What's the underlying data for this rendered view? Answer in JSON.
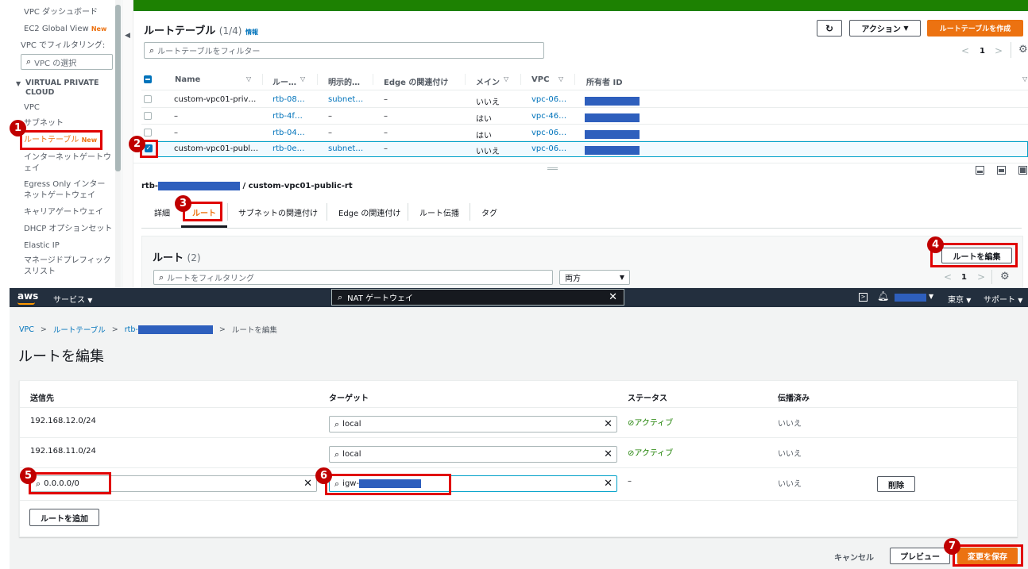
{
  "sidebar": {
    "dashboard": "VPC ダッシュボード",
    "ec2_global_view": "EC2 Global View",
    "new_badge": "New",
    "filter_label": "VPC でフィルタリング:",
    "vpc_select_placeholder": "VPC の選択",
    "section_title": "VIRTUAL PRIVATE CLOUD",
    "items": [
      "VPC",
      "サブネット",
      "ルートテーブル",
      "インターネットゲートウェイ",
      "Egress Only インターネットゲートウェイ",
      "キャリアゲートウェイ",
      "DHCP オプションセット",
      "Elastic IP",
      "マネージドプレフィックスリスト"
    ]
  },
  "top": {
    "title": "ルートテーブル",
    "count": "(1/4)",
    "info": "情報",
    "actions_label": "アクション",
    "create_label": "ルートテーブルを作成",
    "filter_placeholder": "ルートテーブルをフィルター",
    "page": "1",
    "columns": [
      "Name",
      "ルー…",
      "明示的…",
      "Edge の関連付け",
      "メイン",
      "VPC",
      "所有者 ID"
    ],
    "rows": [
      {
        "name": "custom-vpc01-priv…",
        "rt": "rtb-08…",
        "explicit": "subnet…",
        "edge": "–",
        "main": "いいえ",
        "vpc": "vpc-06…"
      },
      {
        "name": "–",
        "rt": "rtb-4f…",
        "explicit": "–",
        "edge": "–",
        "main": "はい",
        "vpc": "vpc-46…"
      },
      {
        "name": "–",
        "rt": "rtb-04…",
        "explicit": "–",
        "edge": "–",
        "main": "はい",
        "vpc": "vpc-06…"
      },
      {
        "name": "custom-vpc01-publ…",
        "rt": "rtb-0e…",
        "explicit": "subnet…",
        "edge": "–",
        "main": "いいえ",
        "vpc": "vpc-06…"
      }
    ]
  },
  "detail": {
    "prefix": "rtb-",
    "suffix": "/ custom-vpc01-public-rt",
    "tabs": [
      "詳細",
      "ルート",
      "サブネットの関連付け",
      "Edge の関連付け",
      "ルート伝播",
      "タグ"
    ],
    "routes_title": "ルート",
    "routes_count": "(2)",
    "edit_routes_label": "ルートを編集",
    "route_filter_placeholder": "ルートをフィルタリング",
    "both_option": "両方",
    "page": "1"
  },
  "awsnav": {
    "logo": "aws",
    "services": "サービス",
    "search_value": "NAT ゲートウェイ",
    "region": "東京",
    "support": "サポート"
  },
  "edit": {
    "breadcrumb": [
      "VPC",
      "ルートテーブル",
      "rtb-",
      "ルートを編集"
    ],
    "title": "ルートを編集",
    "columns": [
      "送信先",
      "ターゲット",
      "ステータス",
      "伝播済み"
    ],
    "rows": [
      {
        "dest": "192.168.12.0/24",
        "target": "local",
        "status": "アクティブ",
        "propagated": "いいえ"
      },
      {
        "dest": "192.168.11.0/24",
        "target": "local",
        "status": "アクティブ",
        "propagated": "いいえ"
      },
      {
        "dest": "0.0.0.0/0",
        "target": "igw-",
        "status": "–",
        "propagated": "いいえ",
        "remove": "削除"
      }
    ],
    "add_route": "ルートを追加",
    "cancel": "キャンセル",
    "preview": "プレビュー",
    "save": "変更を保存"
  },
  "markers": [
    "1",
    "2",
    "3",
    "4",
    "5",
    "6",
    "7"
  ],
  "colors": {
    "accent": "#ec7211",
    "link": "#0073bb",
    "highlight": "#e00000",
    "redaction": "#2e5fbd",
    "aws_nav": "#232f3e",
    "top_bar": "#1d8102"
  }
}
